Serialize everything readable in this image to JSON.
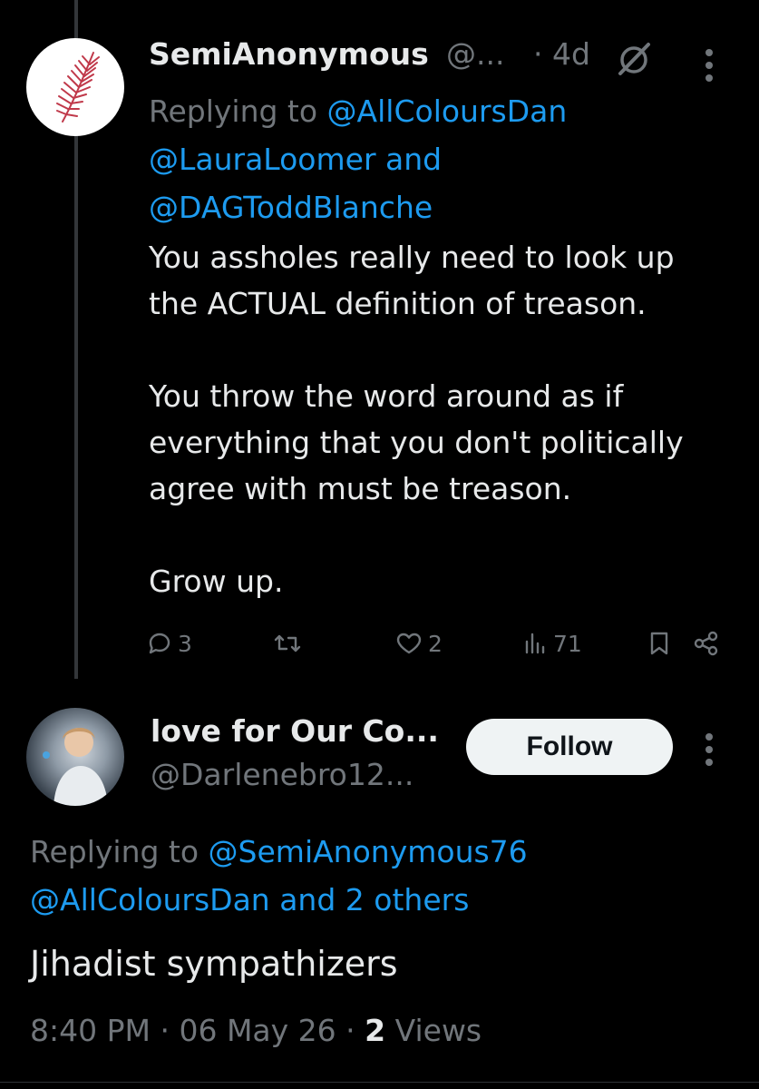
{
  "tweet1": {
    "display_name": "SemiAnonymous",
    "handle": "@...",
    "time": "· 4d",
    "replying_prefix": "Replying to ",
    "replying_line1": "@AllColoursDan",
    "replying_line2": "@LauraLoomer and",
    "replying_line3": "@DAGToddBlanche",
    "paragraphs": [
      "You assholes really need to look up the ACTUAL definition of treason.",
      "You throw the word around as if everything that you don't politically agree with must be treason.",
      "Grow up."
    ],
    "actions": {
      "replies": "3",
      "reposts": "",
      "likes": "2",
      "views": "71"
    }
  },
  "tweet2": {
    "display_name": "love for Our Co...",
    "handle": "@Darlenebro12...",
    "follow_label": "Follow",
    "replying_prefix": "Replying to ",
    "replying_line1": "@SemiAnonymous76",
    "replying_line2": "@AllColoursDan and 2 others",
    "text": "Jihadist sympathizers",
    "time": "8:40 PM",
    "date": "06 May 26",
    "views_count": "2",
    "views_label": "Views"
  },
  "colors": {
    "background": "#000000",
    "text": "#e7e9ea",
    "muted": "#71767b",
    "link": "#1d9bf0",
    "avatar1_accent": "#c0394a"
  },
  "icons": [
    "grok-slash-icon",
    "more-dots-icon",
    "reply-icon",
    "repost-icon",
    "like-icon",
    "views-icon",
    "bookmark-icon",
    "share-icon"
  ]
}
